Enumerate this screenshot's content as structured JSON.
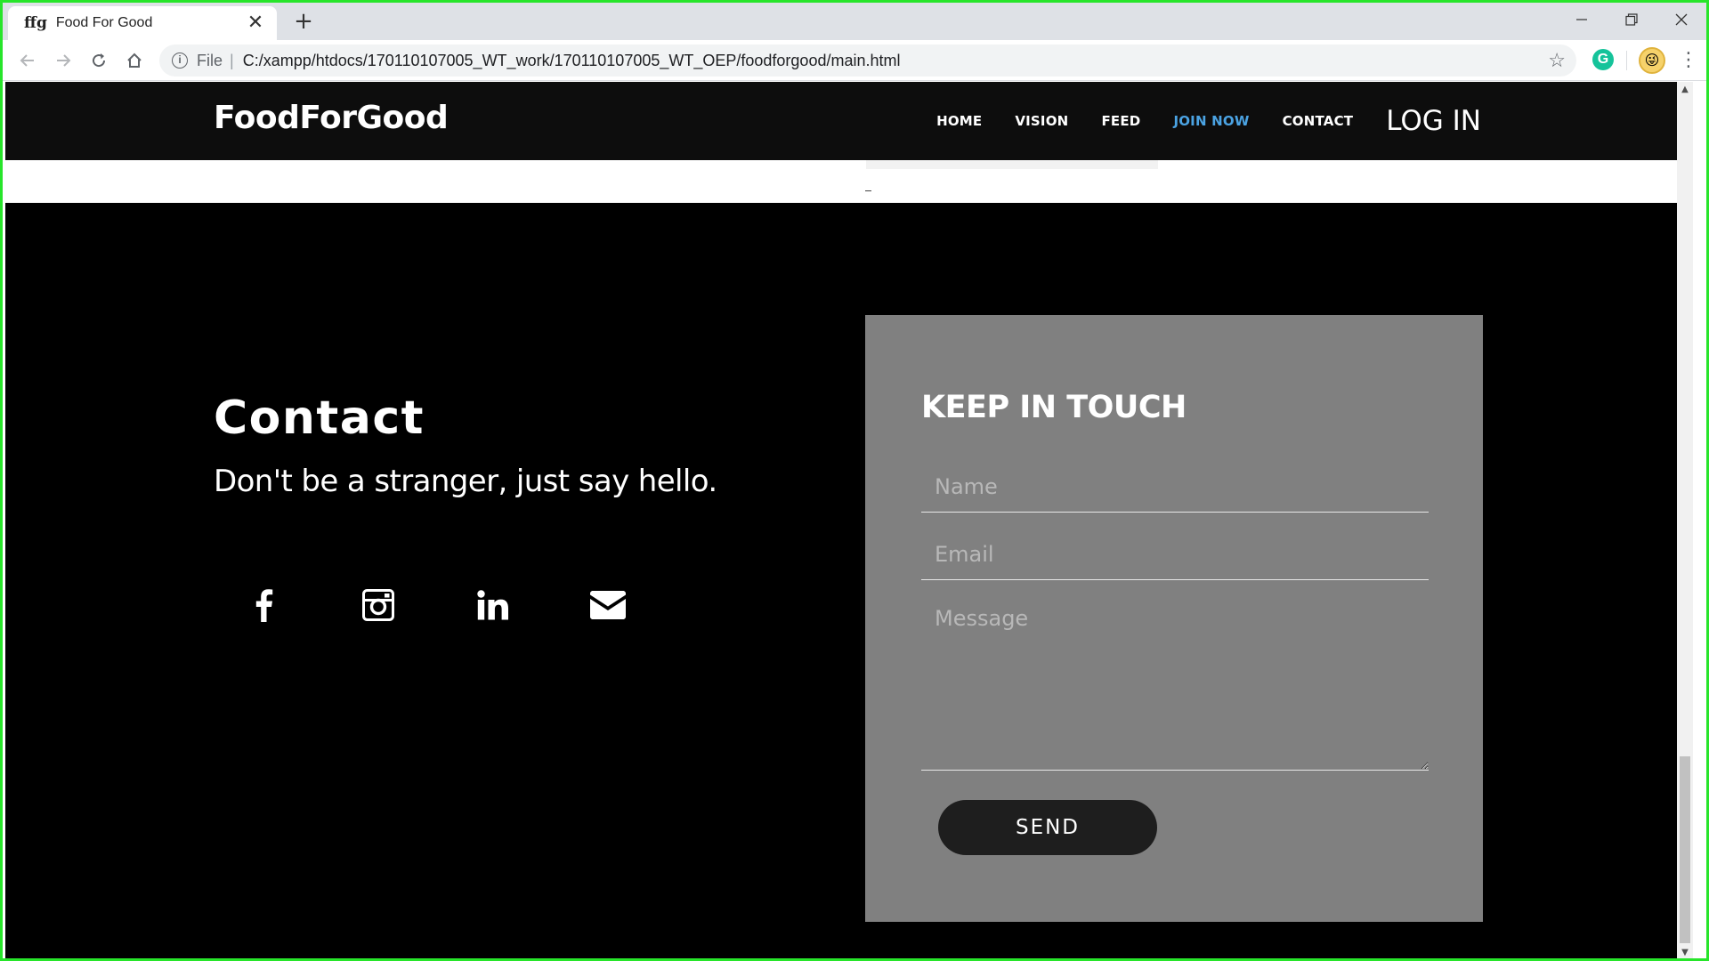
{
  "browser": {
    "tab": {
      "favicon_text": "ffg",
      "title": "Food For Good",
      "close_glyph": "✕"
    },
    "new_tab_glyph": "+",
    "window_controls": {
      "minimize": "—",
      "maximize": "❐",
      "close": "✕"
    },
    "omnibox": {
      "scheme": "File",
      "separator": "|",
      "url": "C:/xampp/htdocs/170110107005_WT_work/170110107005_WT_OEP/foodforgood/main.html"
    },
    "icons": [
      "back-icon",
      "forward-icon",
      "reload-icon",
      "home-icon",
      "info-icon",
      "star-icon",
      "grammarly-icon",
      "avatar-icon",
      "menu-icon"
    ]
  },
  "site": {
    "brand": "FoodForGood",
    "nav": [
      {
        "label": "HOME",
        "active": false
      },
      {
        "label": "VISION",
        "active": false
      },
      {
        "label": "FEED",
        "active": false
      },
      {
        "label": "JOIN NOW",
        "active": true
      },
      {
        "label": "CONTACT",
        "active": false
      }
    ],
    "login_label": "LOG IN"
  },
  "contact": {
    "heading": "Contact",
    "subheading": "Don't be a stranger, just say hello.",
    "social": [
      "facebook-icon",
      "instagram-icon",
      "linkedin-icon",
      "mail-icon"
    ]
  },
  "form": {
    "title": "KEEP IN TOUCH",
    "name_placeholder": "Name",
    "email_placeholder": "Email",
    "message_placeholder": "Message",
    "send_label": "SEND"
  },
  "colors": {
    "page_bg": "#000000",
    "nav_bg": "#0d0d0d",
    "active_link": "#4ba3e3",
    "form_card": "#808080",
    "send_button": "#1e1e1e",
    "frame_border": "#27e52a"
  }
}
